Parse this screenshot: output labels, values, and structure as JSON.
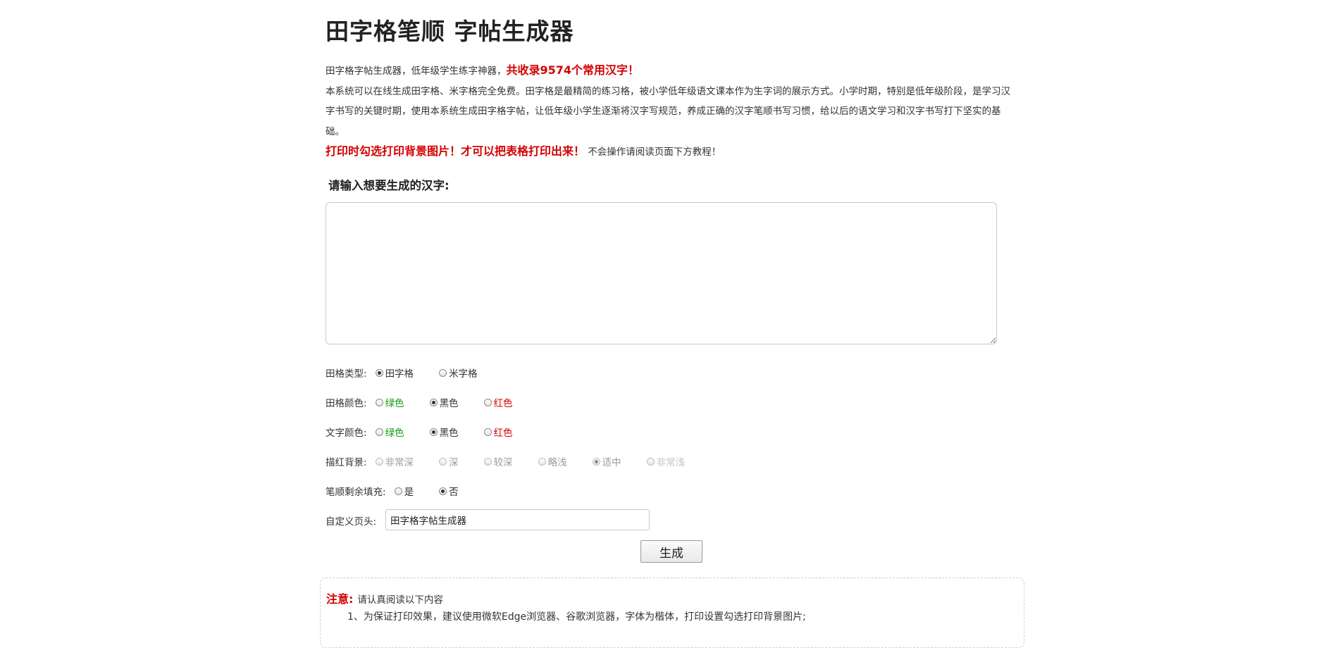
{
  "page": {
    "title": "田字格笔顺 字帖生成器"
  },
  "intro": {
    "line1_prefix": "田字格字帖生成器，低年级学生练字神器，",
    "line1_highlight": "共收录9574个常用汉字！",
    "paragraph": "本系统可以在线生成田字格、米字格完全免费。田字格是最精简的练习格，被小学低年级语文课本作为生字词的展示方式。小学时期，特别是低年级阶段，是学习汉字书写的关键时期，使用本系统生成田字格字帖，让低年级小学生逐渐将汉字写规范，养成正确的汉字笔顺书写习惯，给以后的语文学习和汉字书写打下坚实的基础。",
    "print_tip_highlight": "打印时勾选打印背景图片！才可以把表格打印出来！",
    "print_tip_suffix": "不会操作请阅读页面下方教程！"
  },
  "form": {
    "prompt": "请输入想要生成的汉字:",
    "textarea_value": "",
    "grid_type": {
      "label": "田格类型:",
      "options": [
        {
          "label": "田字格",
          "selected": true
        },
        {
          "label": "米字格",
          "selected": false
        }
      ]
    },
    "grid_color": {
      "label": "田格颜色:",
      "options": [
        {
          "label": "绿色",
          "color": "#139b13",
          "selected": false
        },
        {
          "label": "黑色",
          "color": "#333333",
          "selected": true
        },
        {
          "label": "红色",
          "color": "#d40000",
          "selected": false
        }
      ]
    },
    "text_color": {
      "label": "文字颜色:",
      "options": [
        {
          "label": "绿色",
          "color": "#139b13",
          "selected": false
        },
        {
          "label": "黑色",
          "color": "#333333",
          "selected": true
        },
        {
          "label": "红色",
          "color": "#d40000",
          "selected": false
        }
      ]
    },
    "trace_bg": {
      "label": "描红背景:",
      "disabled": true,
      "options": [
        {
          "label": "非常深",
          "selected": false
        },
        {
          "label": "深",
          "selected": false
        },
        {
          "label": "较深",
          "selected": false
        },
        {
          "label": "略浅",
          "selected": false
        },
        {
          "label": "适中",
          "selected": true
        },
        {
          "label": "非常浅",
          "selected": false
        }
      ]
    },
    "stroke_fill": {
      "label": "笔顺剩余填充:",
      "options": [
        {
          "label": "是",
          "selected": false
        },
        {
          "label": "否",
          "selected": true
        }
      ]
    },
    "custom_header": {
      "label": "自定义页头:",
      "value": "田字格字帖生成器"
    },
    "generate_label": "生成"
  },
  "notice": {
    "title": "注意:",
    "subtitle": "请认真阅读以下内容",
    "item1": "1、为保证打印效果，建议使用微软Edge浏览器、谷歌浏览器，字体为楷体，打印设置勾选打印背景图片;"
  },
  "colors": {
    "accent_red": "#d40000",
    "green": "#139b13",
    "text": "#333333"
  }
}
